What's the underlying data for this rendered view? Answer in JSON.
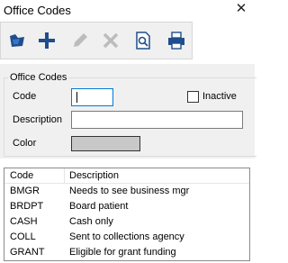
{
  "window": {
    "title": "Office Codes",
    "close_icon": "close-icon"
  },
  "toolbar": {
    "buttons": [
      {
        "name": "open-icon",
        "enabled": true
      },
      {
        "name": "add-icon",
        "enabled": true
      },
      {
        "name": "edit-icon",
        "enabled": false
      },
      {
        "name": "delete-icon",
        "enabled": false
      },
      {
        "name": "search-icon",
        "enabled": true
      },
      {
        "name": "print-icon",
        "enabled": true
      }
    ]
  },
  "form": {
    "group_label": "Office Codes",
    "code_label": "Code",
    "code_value": "",
    "inactive_label": "Inactive",
    "inactive_checked": false,
    "description_label": "Description",
    "description_value": "",
    "color_label": "Color",
    "color_value": "#c8c8c8"
  },
  "list": {
    "columns": [
      "Code",
      "Description"
    ],
    "rows": [
      {
        "code": "BMGR",
        "description": "Needs to see business mgr"
      },
      {
        "code": "BRDPT",
        "description": "Board patient"
      },
      {
        "code": "CASH",
        "description": "Cash only"
      },
      {
        "code": "COLL",
        "description": "Sent to collections agency"
      },
      {
        "code": "GRANT",
        "description": "Eligible for grant funding"
      }
    ]
  },
  "colors": {
    "panel_bg": "#f0f0f0",
    "focus_border": "#0078d7",
    "toolbar_blue": "#1f4e8c"
  }
}
